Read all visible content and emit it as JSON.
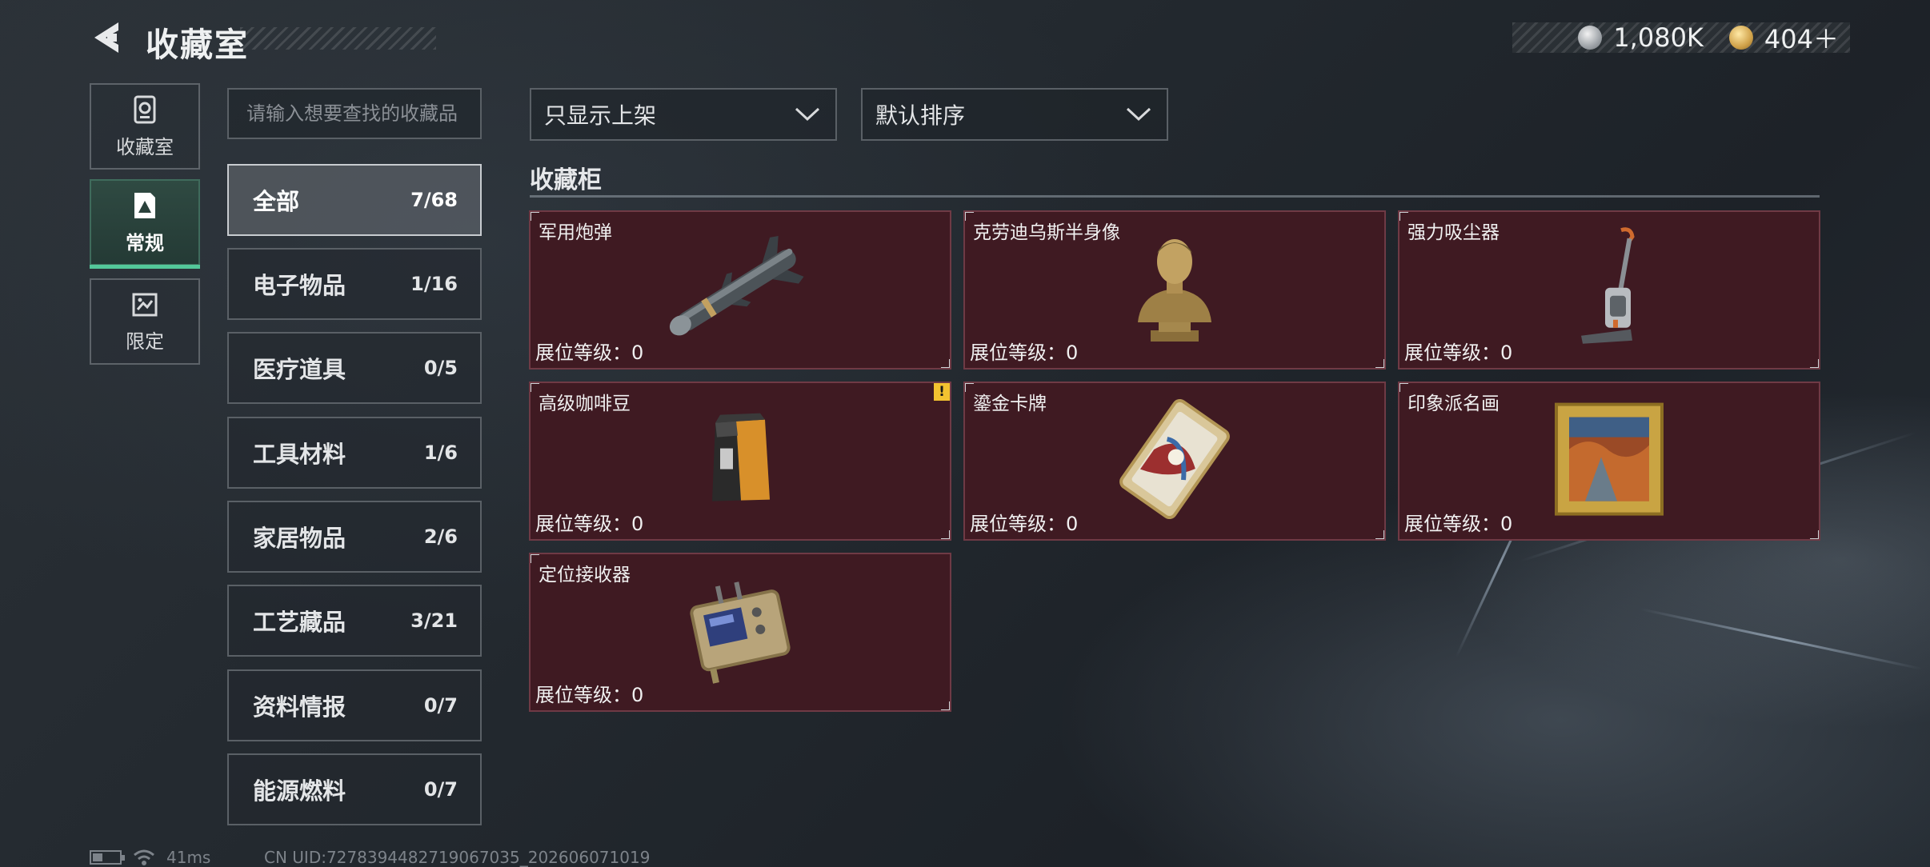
{
  "header": {
    "title": "收藏室",
    "currency": [
      {
        "icon": "silver-coin-icon",
        "value": "1,080K"
      },
      {
        "icon": "gold-coin-icon",
        "value": "404＋"
      }
    ]
  },
  "nav": [
    {
      "label": "收藏室",
      "icon": "collection-room-icon",
      "active": false
    },
    {
      "label": "常规",
      "icon": "regular-icon",
      "active": true
    },
    {
      "label": "限定",
      "icon": "limited-icon",
      "active": false
    }
  ],
  "search": {
    "placeholder": "请输入想要查找的收藏品"
  },
  "categories": [
    {
      "name": "全部",
      "count": "7/68",
      "active": true
    },
    {
      "name": "电子物品",
      "count": "1/16"
    },
    {
      "name": "医疗道具",
      "count": "0/5"
    },
    {
      "name": "工具材料",
      "count": "1/6"
    },
    {
      "name": "家居物品",
      "count": "2/6"
    },
    {
      "name": "工艺藏品",
      "count": "3/21"
    },
    {
      "name": "资料情报",
      "count": "0/7"
    },
    {
      "name": "能源燃料",
      "count": "0/7"
    }
  ],
  "filters": {
    "show_filter": "只显示上架",
    "sort": "默认排序"
  },
  "section": {
    "title": "收藏柜"
  },
  "items": [
    {
      "name": "军用炮弹",
      "level": "展位等级：0",
      "icon": "missile-icon"
    },
    {
      "name": "克劳迪乌斯半身像",
      "level": "展位等级：0",
      "icon": "bust-statue-icon"
    },
    {
      "name": "强力吸尘器",
      "level": "展位等级：0",
      "icon": "vacuum-cleaner-icon"
    },
    {
      "name": "高级咖啡豆",
      "level": "展位等级：0",
      "icon": "coffee-bag-icon",
      "warning": "!"
    },
    {
      "name": "鎏金卡牌",
      "level": "展位等级：0",
      "icon": "gilded-card-icon"
    },
    {
      "name": "印象派名画",
      "level": "展位等级：0",
      "icon": "framed-painting-icon"
    },
    {
      "name": "定位接收器",
      "level": "展位等级：0",
      "icon": "gps-receiver-icon"
    }
  ],
  "status_bar": {
    "ping": "41ms",
    "uid": "CN UID:7278394482719067035_202606071019"
  },
  "colors": {
    "card_bg": "#3f1a22",
    "active_accent": "#53c89a",
    "warning": "#f2c230"
  }
}
